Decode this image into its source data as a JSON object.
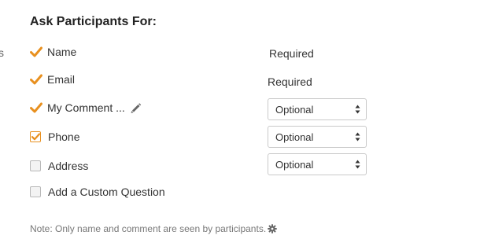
{
  "edge_fragment": "s",
  "heading": "Ask Participants For:",
  "fields": {
    "name": {
      "label": "Name",
      "status": "Required"
    },
    "email": {
      "label": "Email",
      "status": "Required"
    },
    "comment": {
      "label": "My Comment ...",
      "option": "Optional"
    },
    "phone": {
      "label": "Phone",
      "option": "Optional",
      "checked": true
    },
    "address": {
      "label": "Address",
      "option": "Optional",
      "checked": false
    },
    "custom": {
      "label": "Add a Custom Question",
      "checked": false
    }
  },
  "note": "Note: Only name and comment are seen by participants.",
  "icons": {
    "check": "checkmark-icon",
    "edit": "pencil-icon",
    "settings": "gear-icon",
    "select": "up-down-arrows-icon"
  },
  "colors": {
    "accent": "#e8901f",
    "text": "#333333",
    "muted": "#777777",
    "border": "#c9c9c9"
  }
}
